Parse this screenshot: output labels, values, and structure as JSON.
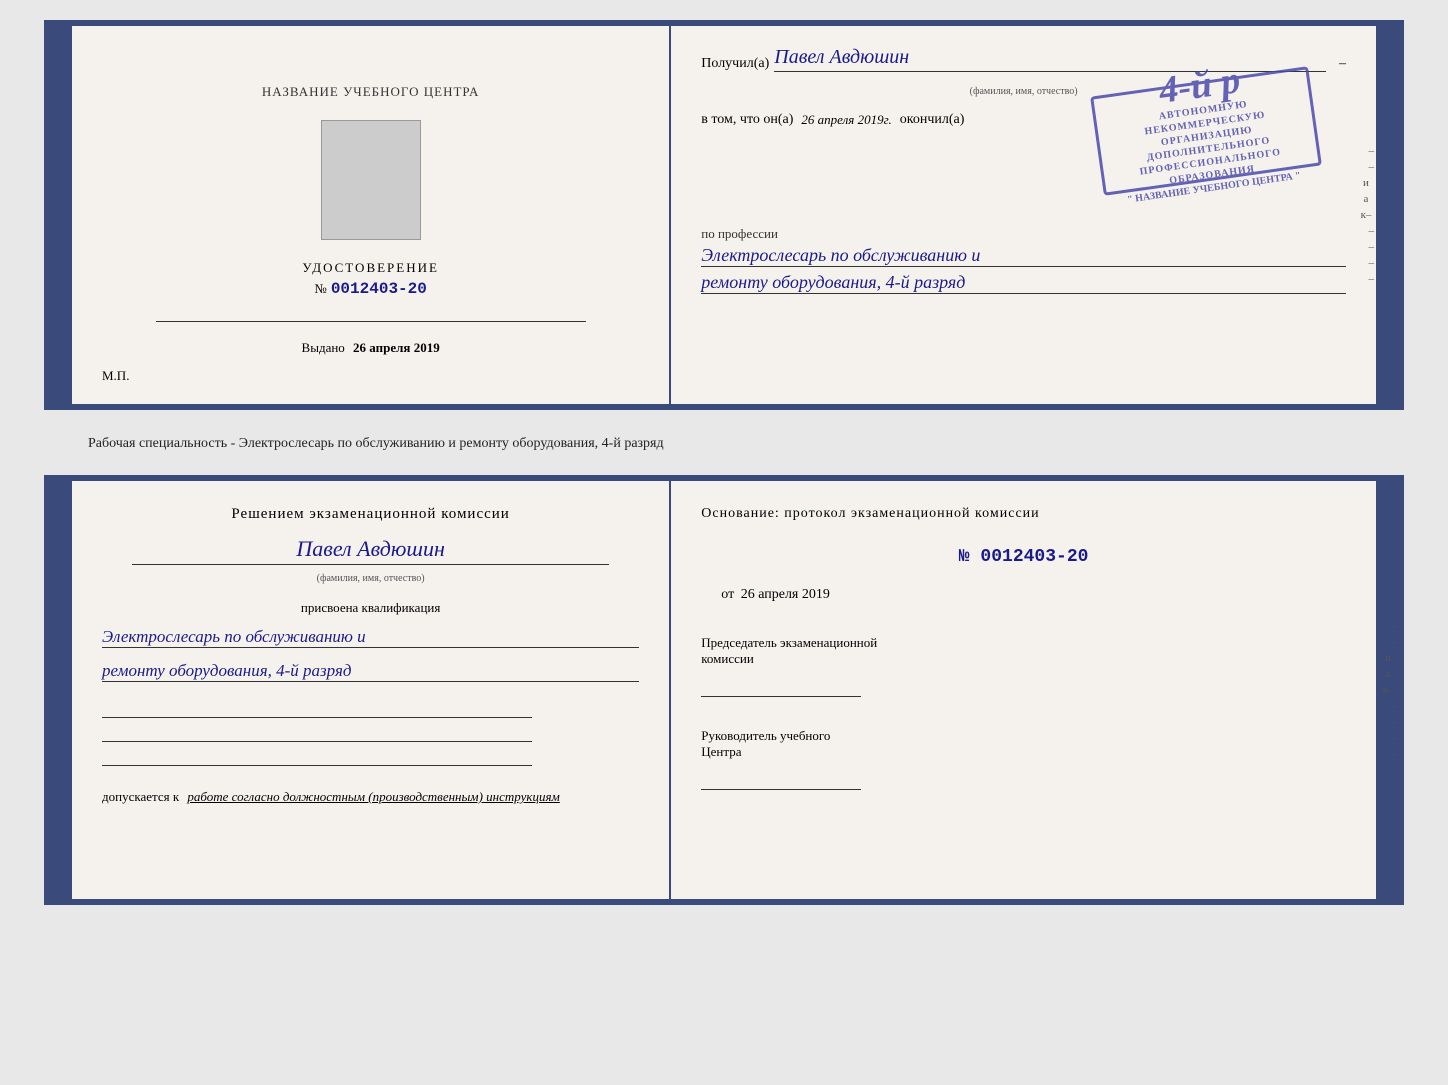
{
  "page": {
    "background_color": "#e8e8e8"
  },
  "top_document": {
    "left": {
      "training_center_label": "НАЗВАНИЕ УЧЕБНОГО ЦЕНТРА",
      "certificate_label": "УДОСТОВЕРЕНИЕ",
      "number_prefix": "№",
      "number": "0012403-20",
      "issued_label": "Выдано",
      "issued_date": "26 апреля 2019",
      "mp_label": "М.П."
    },
    "right": {
      "received_prefix": "Получил(а)",
      "received_name": "Павел Авдюшин",
      "name_caption": "(фамилия, имя, отчество)",
      "in_that_prefix": "в том, что он(а)",
      "completed_date": "26 апреля 2019г.",
      "completed_suffix": "окончил(а)",
      "stamp_line1": "АВТОНОМНУЮ НЕКОММЕРЧЕСКУЮ ОРГАНИЗАЦИЮ",
      "stamp_line2": "ДОПОЛНИТЕЛЬНОГО ПРОФЕССИОНАЛЬНОГО ОБРАЗОВАНИЯ",
      "stamp_line3": "\" НАЗВАНИЕ УЧЕБНОГО ЦЕНТРА \"",
      "stamp_big_text": "4-й р",
      "profession_label": "по профессии",
      "profession_line1": "Электрослесарь по обслуживанию и",
      "profession_line2": "ремонту оборудования, 4-й разряд"
    }
  },
  "separator": {
    "text": "Рабочая специальность - Электрослесарь по обслуживанию и ремонту оборудования, 4-й разряд"
  },
  "bottom_document": {
    "left": {
      "decision_title": "Решением экзаменационной комиссии",
      "person_name": "Павел Авдюшин",
      "name_caption": "(фамилия, имя, отчество)",
      "assigned_label": "присвоена квалификация",
      "qualification_line1": "Электрослесарь по обслуживанию и",
      "qualification_line2": "ремонту оборудования, 4-й разряд",
      "allowed_prefix": "допускается к",
      "allowed_italic": "работе согласно должностным (производственным) инструкциям"
    },
    "right": {
      "basis_title": "Основание: протокол экзаменационной комиссии",
      "number_prefix": "№",
      "protocol_number": "0012403-20",
      "from_prefix": "от",
      "from_date": "26 апреля 2019",
      "chairman_line1": "Председатель экзаменационной",
      "chairman_line2": "комиссии",
      "director_line1": "Руководитель учебного",
      "director_line2": "Центра"
    }
  }
}
